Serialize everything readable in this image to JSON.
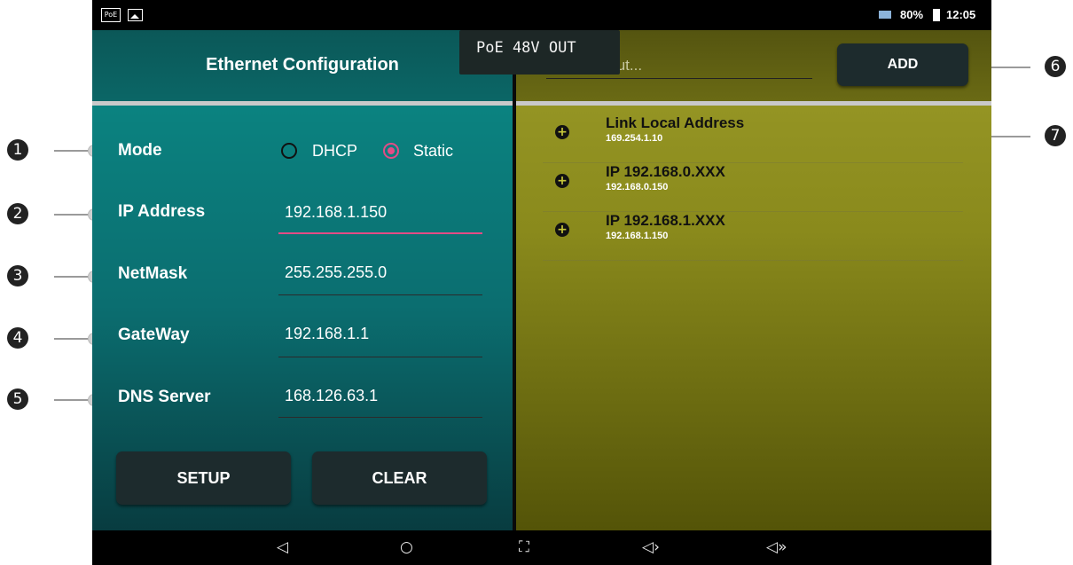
{
  "status_bar": {
    "poe_icon_label": "PoE",
    "battery_percent": "80%",
    "time": "12:05"
  },
  "poe_overlay": "PoE 48V OUT",
  "left_panel": {
    "title": "Ethernet Configuration",
    "mode_label": "Mode",
    "mode_options": [
      {
        "label": "DHCP",
        "selected": false
      },
      {
        "label": "Static",
        "selected": true
      }
    ],
    "fields": [
      {
        "label": "IP Address",
        "value": "192.168.1.150"
      },
      {
        "label": "NetMask",
        "value": "255.255.255.0"
      },
      {
        "label": "GateWay",
        "value": "192.168.1.1"
      },
      {
        "label": "DNS Server",
        "value": "168.126.63.1"
      }
    ],
    "setup_label": "SETUP",
    "clear_label": "CLEAR"
  },
  "right_panel": {
    "name_input_placeholder": "Name Input...",
    "add_label": "ADD",
    "items": [
      {
        "title": "Link Local Address",
        "subtitle": "169.254.1.10"
      },
      {
        "title": "IP 192.168.0.XXX",
        "subtitle": "192.168.0.150"
      },
      {
        "title": "IP 192.168.1.XXX",
        "subtitle": "192.168.1.150"
      }
    ]
  },
  "callouts": [
    "1",
    "2",
    "3",
    "4",
    "5",
    "6",
    "7"
  ],
  "nav_bar": {
    "back": "◁",
    "home": "○",
    "screenshot": "⛶",
    "volume_down": "◁›",
    "volume_up": "◁»"
  },
  "colors": {
    "accent_pink": "#e34c86",
    "left_panel_teal": "#0b7c7a",
    "right_panel_olive": "#8a8a1c",
    "button_dark": "#1d2b2d"
  }
}
